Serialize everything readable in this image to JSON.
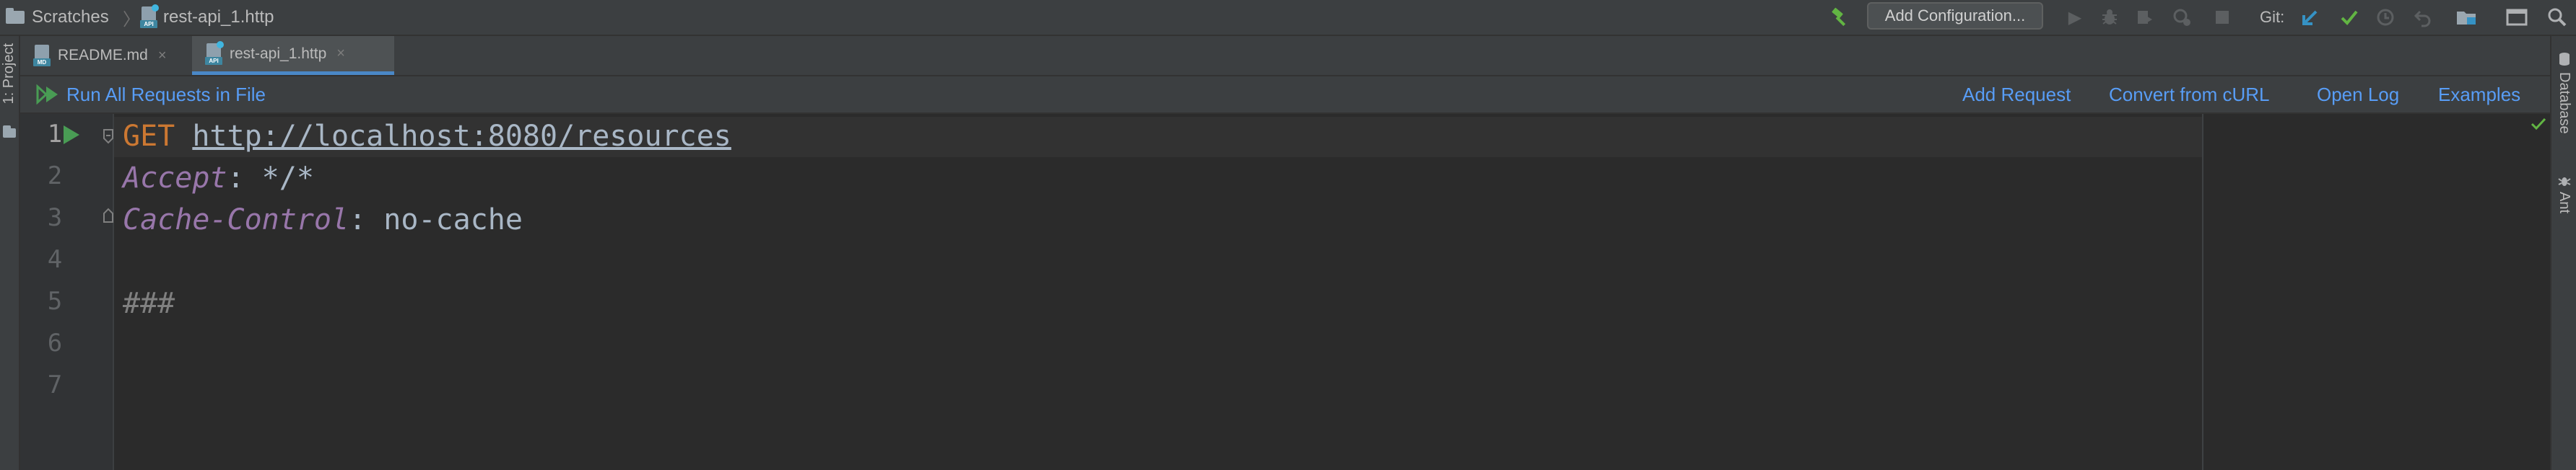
{
  "navbar": {
    "breadcrumb_root": "Scratches",
    "breadcrumb_separator": "〉",
    "breadcrumb_file": "rest-api_1.http",
    "file_icon_tag": "API",
    "add_configuration": "Add Configuration...",
    "git_label": "Git:"
  },
  "left_strip": {
    "project_label": "1: Project"
  },
  "right_strip": {
    "database_label": "Database",
    "ant_label": "Ant"
  },
  "tabs": [
    {
      "label": "README.md",
      "icon_tag": "MD",
      "close": "×"
    },
    {
      "label": "rest-api_1.http",
      "icon_tag": "API",
      "close": "×"
    }
  ],
  "toolbar": {
    "run_all": "Run All Requests in File",
    "add_request": "Add Request",
    "convert_curl": "Convert from cURL",
    "open_log": "Open Log",
    "examples": "Examples"
  },
  "editor": {
    "line_numbers": [
      "1",
      "2",
      "3",
      "4",
      "5",
      "6",
      "7"
    ],
    "line1_method": "GET",
    "line1_url": "http://localhost:8080/resources",
    "line2_key": "Accept",
    "line2_sep": ": ",
    "line2_value": "*/*",
    "line3_key": "Cache-Control",
    "line3_sep": ": ",
    "line3_value": "no-cache",
    "line5_separator": "###"
  },
  "colors": {
    "run_green": "#499c54",
    "link_blue": "#589df6",
    "keyword_orange": "#cc7832",
    "header_purple": "#9876aa"
  }
}
